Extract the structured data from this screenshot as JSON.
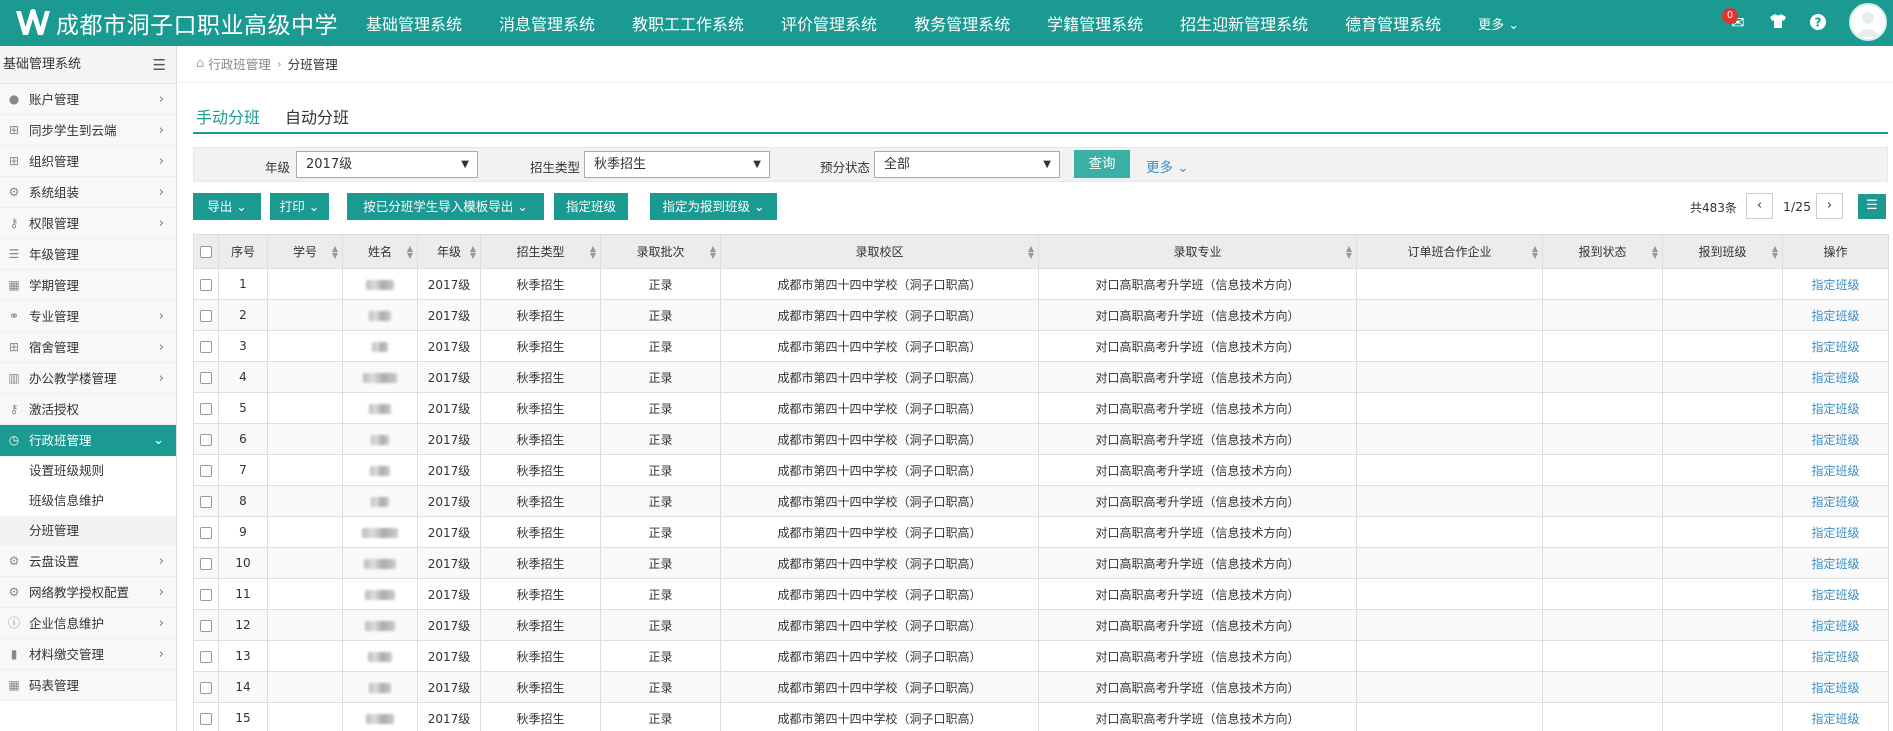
{
  "app": {
    "title": "成都市洞子口职业高级中学",
    "nav": [
      "基础管理系统",
      "消息管理系统",
      "教职工工作系统",
      "评价管理系统",
      "教务管理系统",
      "学籍管理系统",
      "招生迎新管理系统",
      "德育管理系统"
    ],
    "nav_more": "更多 ⌄",
    "notification_count": "0"
  },
  "sidebar": {
    "title": "基础管理系统",
    "items": [
      {
        "label": "账户管理",
        "icon": "user-icon",
        "expandable": true
      },
      {
        "label": "同步学生到云端",
        "icon": "sitemap-icon",
        "expandable": true
      },
      {
        "label": "组织管理",
        "icon": "sitemap-icon",
        "expandable": true
      },
      {
        "label": "系统组装",
        "icon": "gears-icon",
        "expandable": true
      },
      {
        "label": "权限管理",
        "icon": "key-icon",
        "expandable": true
      },
      {
        "label": "年级管理",
        "icon": "list-icon",
        "expandable": false
      },
      {
        "label": "学期管理",
        "icon": "calendar-icon",
        "expandable": false
      },
      {
        "label": "专业管理",
        "icon": "bicycle-icon",
        "expandable": true
      },
      {
        "label": "宿舍管理",
        "icon": "sitemap-icon",
        "expandable": true
      },
      {
        "label": "办公教学楼管理",
        "icon": "building-icon",
        "expandable": true
      },
      {
        "label": "激活授权",
        "icon": "key-icon",
        "expandable": false
      },
      {
        "label": "行政班管理",
        "icon": "clock-icon",
        "expandable": true,
        "active": true
      },
      {
        "label": "云盘设置",
        "icon": "gear-icon",
        "expandable": true
      },
      {
        "label": "网络教学授权配置",
        "icon": "gears-icon",
        "expandable": true
      },
      {
        "label": "企业信息维护",
        "icon": "info-icon",
        "expandable": true
      },
      {
        "label": "材料缴交管理",
        "icon": "bar-chart-icon",
        "expandable": true
      },
      {
        "label": "码表管理",
        "icon": "table-icon",
        "expandable": false
      }
    ],
    "subitems": [
      "设置班级规则",
      "班级信息维护",
      "分班管理"
    ]
  },
  "breadcrumb": {
    "parent": "行政班管理",
    "current": "分班管理"
  },
  "tabs": [
    "手动分班",
    "自动分班"
  ],
  "filters": {
    "grade_label": "年级",
    "grade_value": "2017级",
    "type_label": "招生类型",
    "type_value": "秋季招生",
    "status_label": "预分状态",
    "status_value": "全部",
    "query_button": "查询",
    "more": "更多 ⌄"
  },
  "toolbar": {
    "export": "导出 ⌄",
    "print": "打印 ⌄",
    "template_export": "按已分班学生导入模板导出 ⌄",
    "assign": "指定班级",
    "assign_report": "指定为报到班级 ⌄"
  },
  "pager": {
    "total": "共483条",
    "page": "1/25"
  },
  "table": {
    "headers": [
      "序号",
      "学号",
      "姓名",
      "年级",
      "招生类型",
      "录取批次",
      "录取校区",
      "录取专业",
      "订单班合作企业",
      "报到状态",
      "报到班级",
      "操作"
    ],
    "rows": [
      {
        "no": "1",
        "grade": "2017级",
        "type": "秋季招生",
        "batch": "正录",
        "campus": "成都市第四十四中学校（洞子口职高）",
        "major": "对口高职高考升学班（信息技术方向）",
        "op": "指定班级"
      },
      {
        "no": "2",
        "grade": "2017级",
        "type": "秋季招生",
        "batch": "正录",
        "campus": "成都市第四十四中学校（洞子口职高）",
        "major": "对口高职高考升学班（信息技术方向）",
        "op": "指定班级"
      },
      {
        "no": "3",
        "grade": "2017级",
        "type": "秋季招生",
        "batch": "正录",
        "campus": "成都市第四十四中学校（洞子口职高）",
        "major": "对口高职高考升学班（信息技术方向）",
        "op": "指定班级"
      },
      {
        "no": "4",
        "grade": "2017级",
        "type": "秋季招生",
        "batch": "正录",
        "campus": "成都市第四十四中学校（洞子口职高）",
        "major": "对口高职高考升学班（信息技术方向）",
        "op": "指定班级"
      },
      {
        "no": "5",
        "grade": "2017级",
        "type": "秋季招生",
        "batch": "正录",
        "campus": "成都市第四十四中学校（洞子口职高）",
        "major": "对口高职高考升学班（信息技术方向）",
        "op": "指定班级"
      },
      {
        "no": "6",
        "grade": "2017级",
        "type": "秋季招生",
        "batch": "正录",
        "campus": "成都市第四十四中学校（洞子口职高）",
        "major": "对口高职高考升学班（信息技术方向）",
        "op": "指定班级"
      },
      {
        "no": "7",
        "grade": "2017级",
        "type": "秋季招生",
        "batch": "正录",
        "campus": "成都市第四十四中学校（洞子口职高）",
        "major": "对口高职高考升学班（信息技术方向）",
        "op": "指定班级"
      },
      {
        "no": "8",
        "grade": "2017级",
        "type": "秋季招生",
        "batch": "正录",
        "campus": "成都市第四十四中学校（洞子口职高）",
        "major": "对口高职高考升学班（信息技术方向）",
        "op": "指定班级"
      },
      {
        "no": "9",
        "grade": "2017级",
        "type": "秋季招生",
        "batch": "正录",
        "campus": "成都市第四十四中学校（洞子口职高）",
        "major": "对口高职高考升学班（信息技术方向）",
        "op": "指定班级"
      },
      {
        "no": "10",
        "grade": "2017级",
        "type": "秋季招生",
        "batch": "正录",
        "campus": "成都市第四十四中学校（洞子口职高）",
        "major": "对口高职高考升学班（信息技术方向）",
        "op": "指定班级"
      },
      {
        "no": "11",
        "grade": "2017级",
        "type": "秋季招生",
        "batch": "正录",
        "campus": "成都市第四十四中学校（洞子口职高）",
        "major": "对口高职高考升学班（信息技术方向）",
        "op": "指定班级"
      },
      {
        "no": "12",
        "grade": "2017级",
        "type": "秋季招生",
        "batch": "正录",
        "campus": "成都市第四十四中学校（洞子口职高）",
        "major": "对口高职高考升学班（信息技术方向）",
        "op": "指定班级"
      },
      {
        "no": "13",
        "grade": "2017级",
        "type": "秋季招生",
        "batch": "正录",
        "campus": "成都市第四十四中学校（洞子口职高）",
        "major": "对口高职高考升学班（信息技术方向）",
        "op": "指定班级"
      },
      {
        "no": "14",
        "grade": "2017级",
        "type": "秋季招生",
        "batch": "正录",
        "campus": "成都市第四十四中学校（洞子口职高）",
        "major": "对口高职高考升学班（信息技术方向）",
        "op": "指定班级"
      },
      {
        "no": "15",
        "grade": "2017级",
        "type": "秋季招生",
        "batch": "正录",
        "campus": "成都市第四十四中学校（洞子口职高）",
        "major": "对口高职高考升学班（信息技术方向）",
        "op": "指定班级"
      }
    ]
  },
  "colors": {
    "accent": "#1b9a92",
    "link": "#3f8ec4",
    "badge": "#e5322d"
  }
}
